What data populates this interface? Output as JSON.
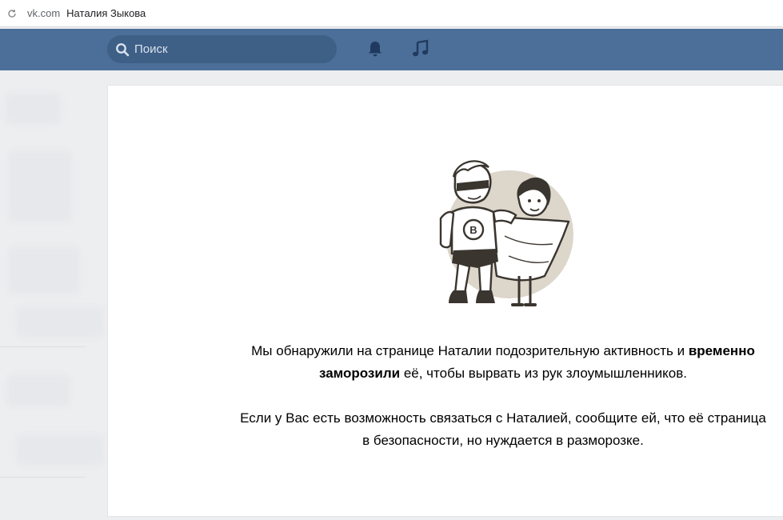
{
  "browser": {
    "domain": "vk.com",
    "tab_title": "Наталия Зыкова"
  },
  "header": {
    "search_placeholder": "Поиск",
    "colors": {
      "bar": "#4c6f99",
      "search_bg": "#3e5f86"
    }
  },
  "icons": {
    "reload": "reload-icon",
    "search": "search-icon",
    "notifications": "bell-icon",
    "music": "music-note-icon",
    "illustration": "superhero-couple-illustration"
  },
  "message": {
    "p1_start": "Мы обнаружили на странице Наталии подозрительную активность и ",
    "p1_bold": "временно заморозили",
    "p1_end": " её, чтобы вырвать из рук злоумышленников.",
    "p2": "Если у Вас есть возможность связаться с Наталией, сообщите ей, что её страница в безопасности, но нуждается в разморозке."
  }
}
